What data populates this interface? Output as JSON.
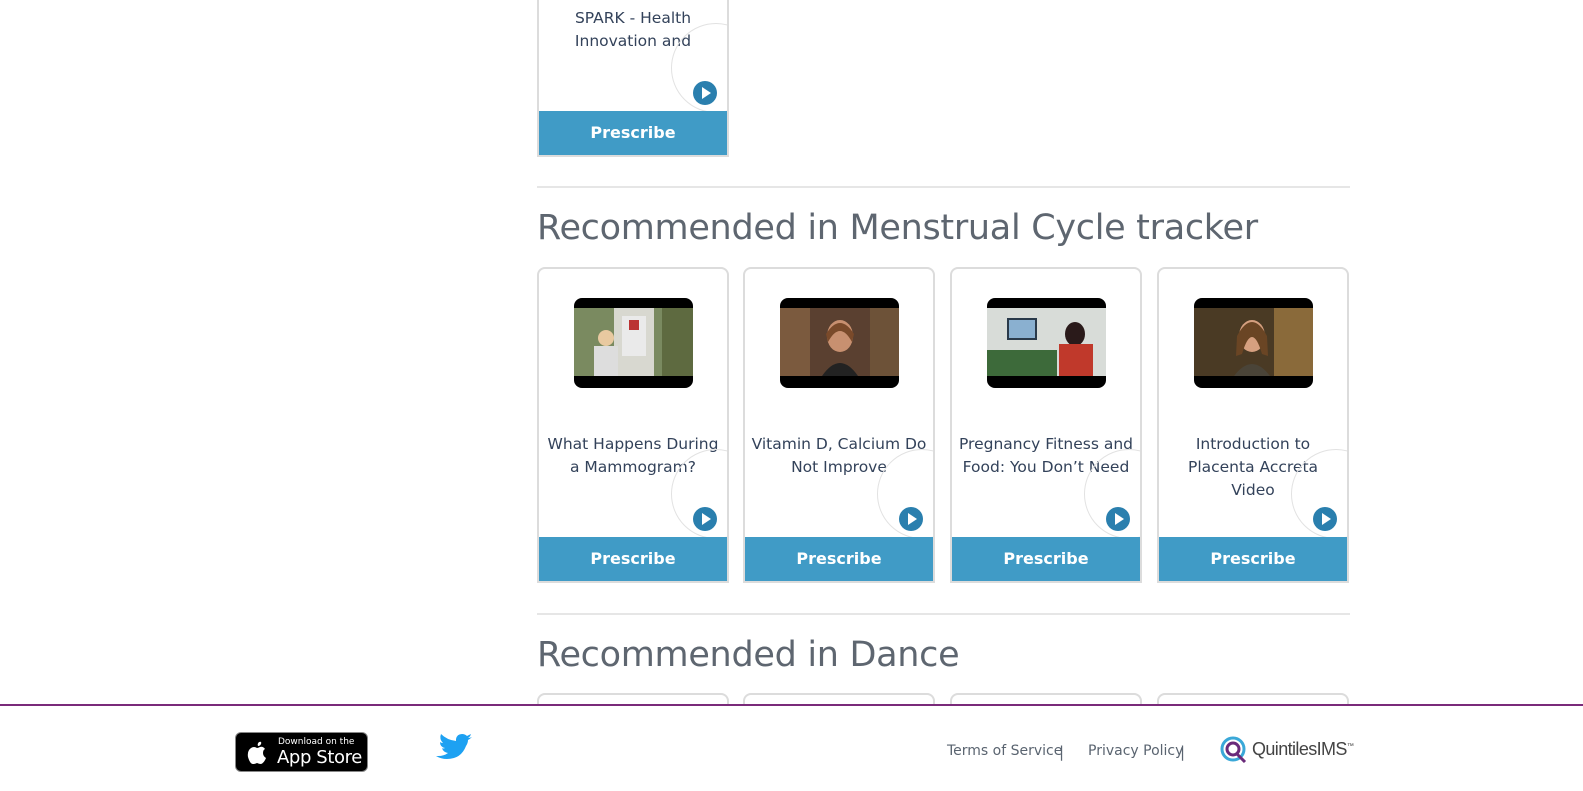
{
  "top_card": {
    "title": "SPARK - Health Innovation and",
    "button": "Prescribe"
  },
  "sections": [
    {
      "title": "Recommended in Menstrual Cycle tracker",
      "cards": [
        {
          "title": "What Happens During a Mammogram?",
          "button": "Prescribe"
        },
        {
          "title": "Vitamin D, Calcium Do Not Improve",
          "button": "Prescribe"
        },
        {
          "title": "Pregnancy Fitness and Food: You Don’t Need",
          "button": "Prescribe"
        },
        {
          "title": "Introduction to Placenta Accreta Video",
          "button": "Prescribe"
        }
      ]
    },
    {
      "title": "Recommended in Dance"
    }
  ],
  "footer": {
    "appstore_small": "Download on the",
    "appstore_big": "App Store",
    "terms": "Terms of Service",
    "privacy": "Privacy Policy",
    "separator": "|",
    "brand": "QuintilesIMS",
    "brand_tm": "™"
  },
  "colors": {
    "prescribe_bg": "#409bc6",
    "play_icon": "#2a7fae",
    "footer_border": "#7a2a7a",
    "title_text": "#33425a"
  }
}
